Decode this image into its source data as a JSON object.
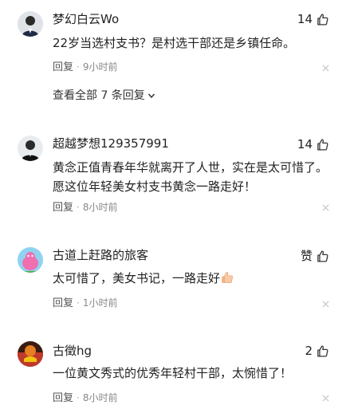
{
  "comments": [
    {
      "username": "梦幻白云Wo",
      "likes": "14",
      "text": "22岁当选村支书？是村选干部还是乡镇任命。",
      "reply": "回复",
      "time": "9小时前",
      "view_all": "查看全部 7 条回复"
    },
    {
      "username": "超越梦想129357991",
      "likes": "14",
      "text": "黄念正值青春年华就离开了人世，实在是太可惜了。愿这位年轻美女村支书黄念一路走好！",
      "reply": "回复",
      "time": "8小时前"
    },
    {
      "username": "古道上赶路的旅客",
      "likes": "赞",
      "text": "太可惜了，美女书记，一路走好",
      "emoji": "thumbs-up-emoji",
      "reply": "回复",
      "time": "1小时前"
    },
    {
      "username": "古徵hg",
      "likes": "2",
      "text": "一位黄文秀式的优秀年轻村干部，太惋惜了！",
      "reply": "回复",
      "time": "8小时前"
    }
  ],
  "icons": {
    "like": "thumbs-up-outline-icon",
    "close": "close-icon",
    "expand": "chevron-down-icon"
  },
  "colors": {
    "text": "#222222",
    "meta": "#888888",
    "close": "#c8c8c8"
  }
}
